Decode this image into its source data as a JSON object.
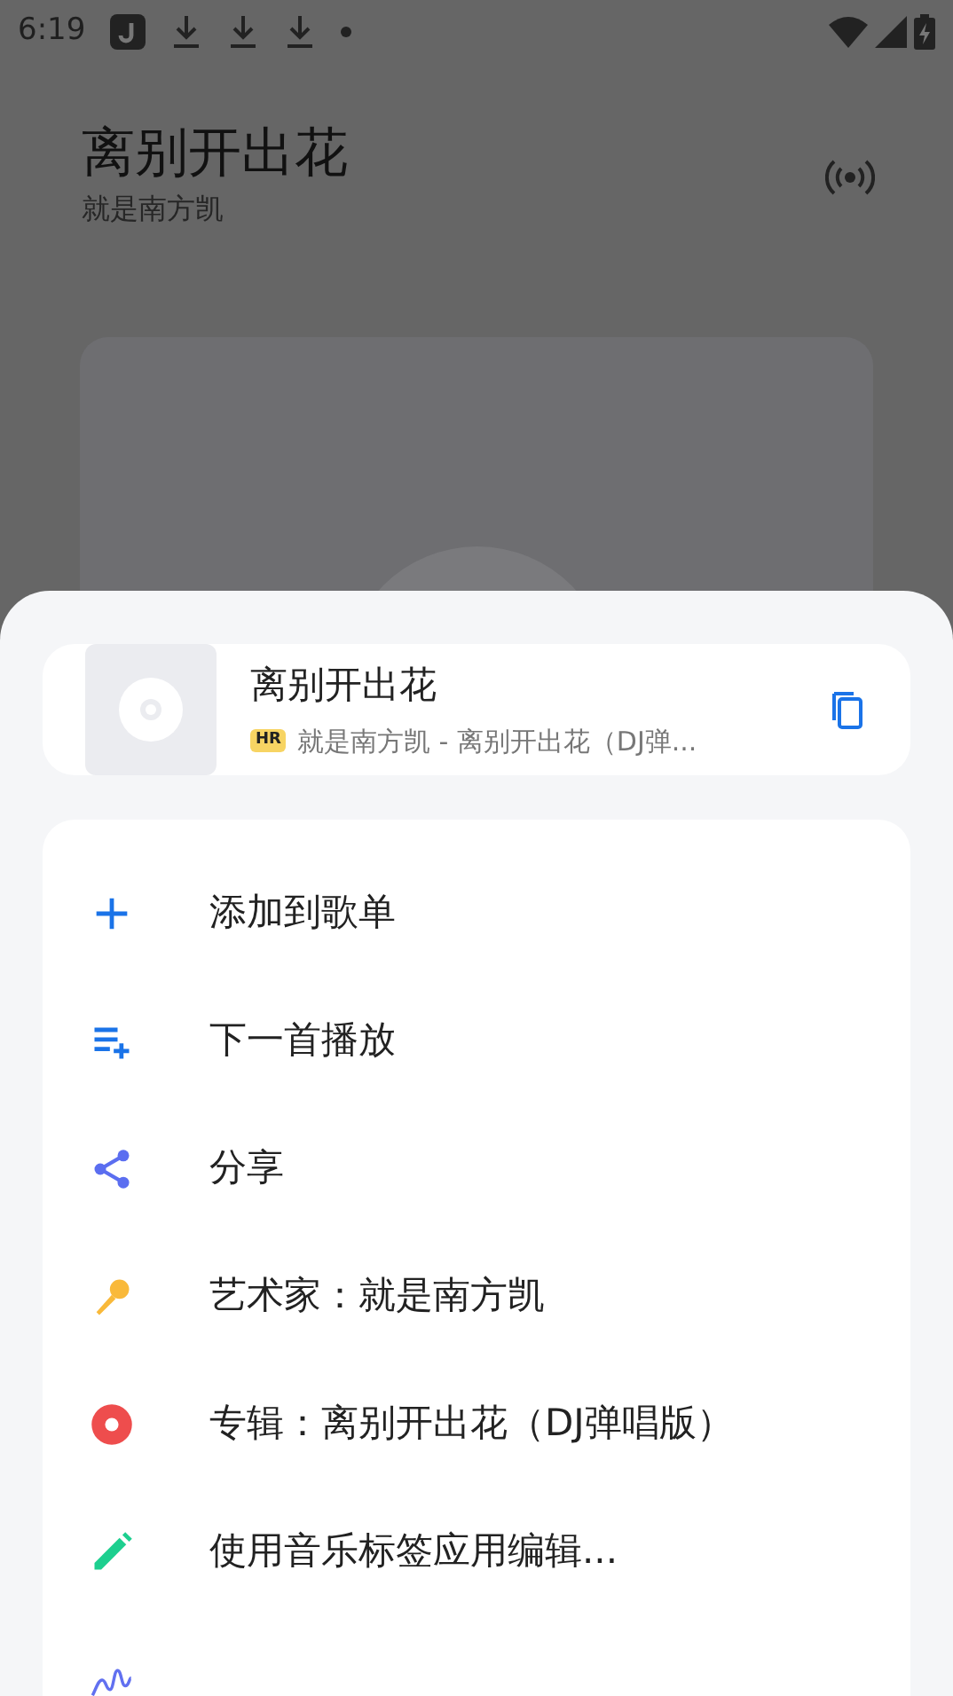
{
  "status_bar": {
    "time": "6:19"
  },
  "player": {
    "title": "离别开出花",
    "artist": "就是南方凯"
  },
  "sheet": {
    "song": {
      "title": "离别开出花",
      "quality_badge": "HR",
      "subtitle": "就是南方凯 - 离别开出花（DJ弹..."
    },
    "actions": [
      {
        "kind": "add",
        "label": "添加到歌单",
        "color": "#1a73e8"
      },
      {
        "kind": "queue",
        "label": "下一首播放",
        "color": "#1a73e8"
      },
      {
        "kind": "share",
        "label": "分享",
        "color": "#5b6ef0"
      },
      {
        "kind": "artist",
        "label": "艺术家：就是南方凯",
        "color": "#f9b93a"
      },
      {
        "kind": "album",
        "label": "专辑：离别开出花（DJ弹唱版）",
        "color": "#ee4d4d"
      },
      {
        "kind": "edit",
        "label": "使用音乐标签应用编辑...",
        "color": "#1dcf8f"
      },
      {
        "kind": "wave",
        "color": "#6170f0"
      }
    ]
  }
}
